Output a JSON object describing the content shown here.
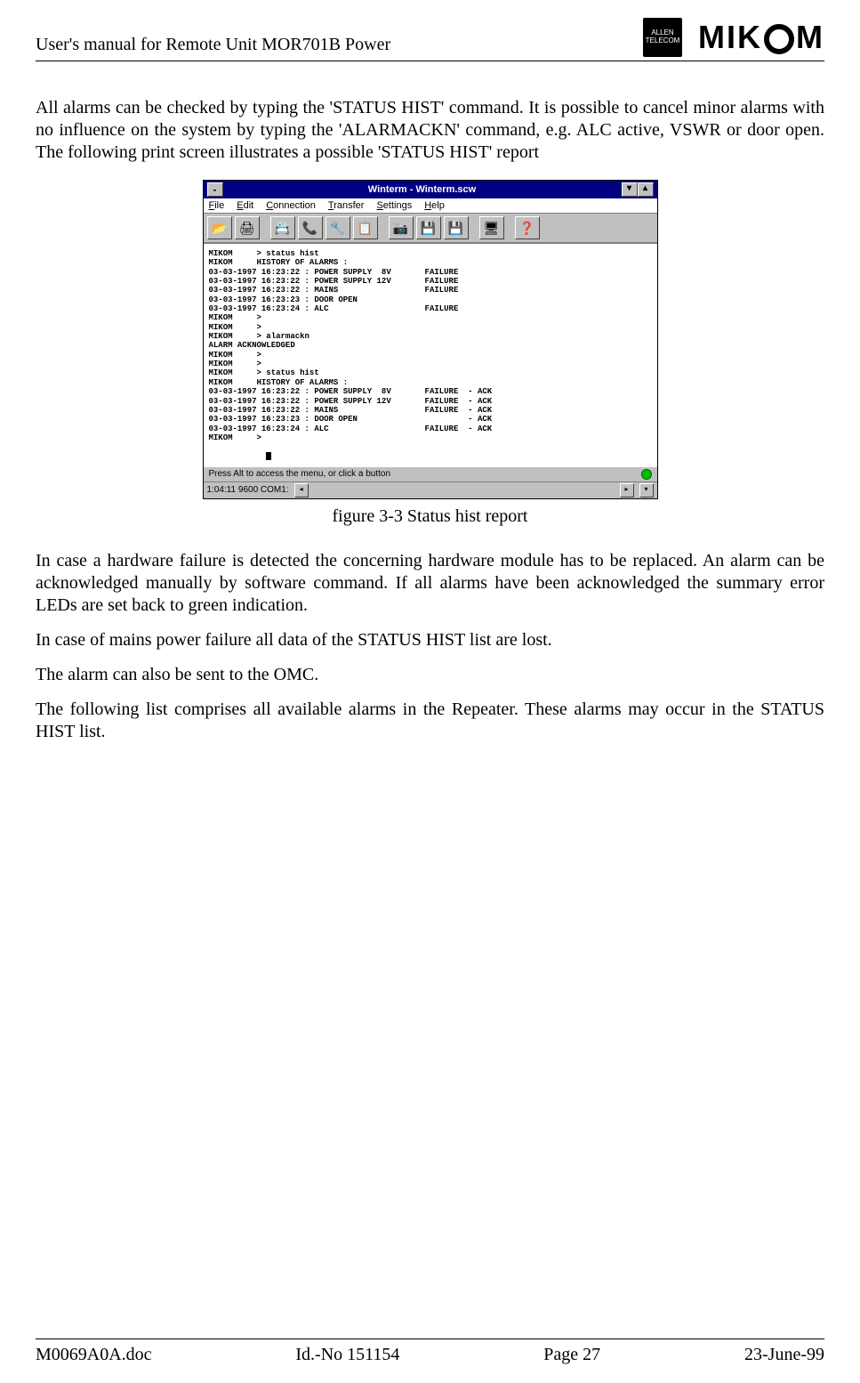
{
  "header": {
    "title": "User's manual for Remote Unit MOR701B Power",
    "logo_allen_line1": "ALLEN",
    "logo_allen_line2": "TELECOM",
    "logo_mikom_left": "MIK",
    "logo_mikom_right": "M"
  },
  "body": {
    "para1": "All alarms can be checked by typing the 'STATUS HIST' command. It is possible to cancel minor alarms with no influence on the system by typing the 'ALARMACKN' command, e.g. ALC active, VSWR or door open. The following print screen illustrates a possible 'STATUS HIST' report",
    "figure_caption": "figure 3-3 Status hist report",
    "para2": "In case a hardware failure is detected the concerning hardware module has to be replaced. An alarm can be acknowledged manually by software command. If all alarms have been acknowledged the summary error LEDs are set back to green indication.",
    "para3": "In case of mains power failure all data of the STATUS HIST list are lost.",
    "para4": "The alarm can also be sent to the OMC.",
    "para5": "The following list comprises all available alarms in the Repeater. These alarms may occur in the STATUS HIST list."
  },
  "winterm": {
    "title": "Winterm - Winterm.scw",
    "menu": [
      "File",
      "Edit",
      "Connection",
      "Transfer",
      "Settings",
      "Help"
    ],
    "toolbar_icons": [
      "📂",
      "🖨",
      "📇",
      "📞",
      "🔧",
      "📋",
      "📷",
      "💾",
      "💾",
      "🖥",
      "❓"
    ],
    "terminal_lines": [
      "MIKOM     > status hist",
      "MIKOM     HISTORY OF ALARMS :",
      "03-03-1997 16:23:22 : POWER SUPPLY  8V       FAILURE",
      "03-03-1997 16:23:22 : POWER SUPPLY 12V       FAILURE",
      "03-03-1997 16:23:22 : MAINS                  FAILURE",
      "03-03-1997 16:23:23 : DOOR OPEN",
      "03-03-1997 16:23:24 : ALC                    FAILURE",
      "MIKOM     >",
      "MIKOM     >",
      "MIKOM     > alarmackn",
      "ALARM ACKNOWLEDGED",
      "MIKOM     >",
      "MIKOM     >",
      "MIKOM     > status hist",
      "MIKOM     HISTORY OF ALARMS :",
      "03-03-1997 16:23:22 : POWER SUPPLY  8V       FAILURE  - ACK",
      "03-03-1997 16:23:22 : POWER SUPPLY 12V       FAILURE  - ACK",
      "03-03-1997 16:23:22 : MAINS                  FAILURE  - ACK",
      "03-03-1997 16:23:23 : DOOR OPEN                       - ACK",
      "03-03-1997 16:23:24 : ALC                    FAILURE  - ACK",
      "MIKOM     >"
    ],
    "status_hint": "Press Alt to access the menu, or click a button",
    "bottom_status": "1:04:11  9600  COM1:"
  },
  "footer": {
    "left": "M0069A0A.doc",
    "center_left": "Id.-No 151154",
    "center_right": "Page 27",
    "right": "23-June-99"
  }
}
